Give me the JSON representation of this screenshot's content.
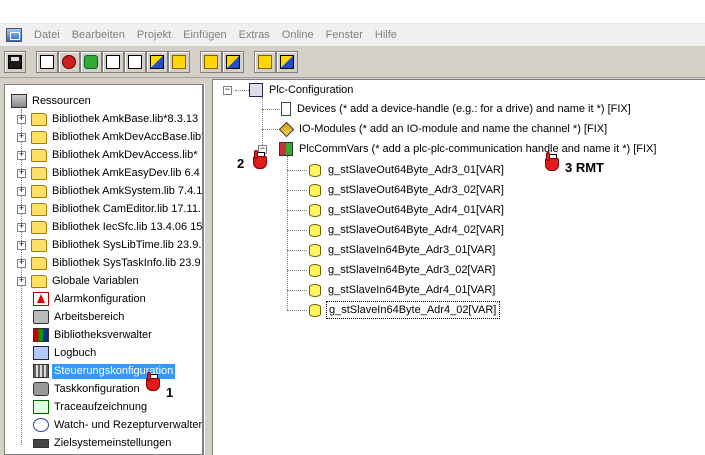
{
  "menu": [
    "Datei",
    "Bearbeiten",
    "Projekt",
    "Einfügen",
    "Extras",
    "Online",
    "Fenster",
    "Hilfe"
  ],
  "toolbar_icons": [
    "save-icon",
    "compile-icon",
    "stop-icon",
    "step-icon",
    "list-icon",
    "doc-icon",
    "load-icon",
    "login-icon",
    "logout-icon",
    "online-icon",
    "offline-icon"
  ],
  "left_tree": {
    "root": "Ressourcen",
    "items": [
      {
        "label": "Bibliothek AmkBase.lib*8.3.13",
        "type": "folder",
        "expandable": true
      },
      {
        "label": "Bibliothek AmkDevAccBase.lib*",
        "type": "folder",
        "expandable": true
      },
      {
        "label": "Bibliothek AmkDevAccess.lib*",
        "type": "folder",
        "expandable": true
      },
      {
        "label": "Bibliothek AmkEasyDev.lib 6.4",
        "type": "folder",
        "expandable": true
      },
      {
        "label": "Bibliothek AmkSystem.lib 7.4.1",
        "type": "folder",
        "expandable": true
      },
      {
        "label": "Bibliothek CamEditor.lib 17.11.",
        "type": "folder",
        "expandable": true
      },
      {
        "label": "Bibliothek IecSfc.lib 13.4.06 15",
        "type": "folder",
        "expandable": true
      },
      {
        "label": "Bibliothek SysLibTime.lib 23.9.",
        "type": "folder",
        "expandable": true
      },
      {
        "label": "Bibliothek SysTaskInfo.lib 23.9",
        "type": "folder",
        "expandable": true
      },
      {
        "label": "Globale Variablen",
        "type": "folder",
        "expandable": true
      },
      {
        "label": "Alarmkonfiguration",
        "type": "alarm"
      },
      {
        "label": "Arbeitsbereich",
        "type": "work"
      },
      {
        "label": "Bibliotheksverwalter",
        "type": "lib"
      },
      {
        "label": "Logbuch",
        "type": "log"
      },
      {
        "label": "Steuerungskonfiguration",
        "type": "cfg",
        "selected": true
      },
      {
        "label": "Taskkonfiguration",
        "type": "task"
      },
      {
        "label": "Traceaufzeichnung",
        "type": "trace"
      },
      {
        "label": "Watch- und Rezepturverwalter",
        "type": "watch"
      },
      {
        "label": "Zielsystemeinstellungen",
        "type": "target"
      }
    ]
  },
  "right_tree": {
    "root": "Plc-Configuration",
    "children": [
      {
        "label": "Devices (* add a device-handle (e.g.: for a drive) and name it *) [FIX]",
        "type": "dev"
      },
      {
        "label": "IO-Modules (* add an IO-module and name the channel *) [FIX]",
        "type": "io"
      },
      {
        "label": "PlcCommVars (* add a plc-plc-communication handle and name it *) [FIX]",
        "type": "comm"
      }
    ],
    "vars": [
      "g_stSlaveOut64Byte_Adr3_01[VAR]",
      "g_stSlaveOut64Byte_Adr3_02[VAR]",
      "g_stSlaveOut64Byte_Adr4_01[VAR]",
      "g_stSlaveOut64Byte_Adr4_02[VAR]",
      "g_stSlaveIn64Byte_Adr3_01[VAR]",
      "g_stSlaveIn64Byte_Adr3_02[VAR]",
      "g_stSlaveIn64Byte_Adr4_01[VAR]",
      "g_stSlaveIn64Byte_Adr4_02[VAR]"
    ]
  },
  "annotations": {
    "step1": "1",
    "step2": "2",
    "step3": "3 RMT"
  }
}
